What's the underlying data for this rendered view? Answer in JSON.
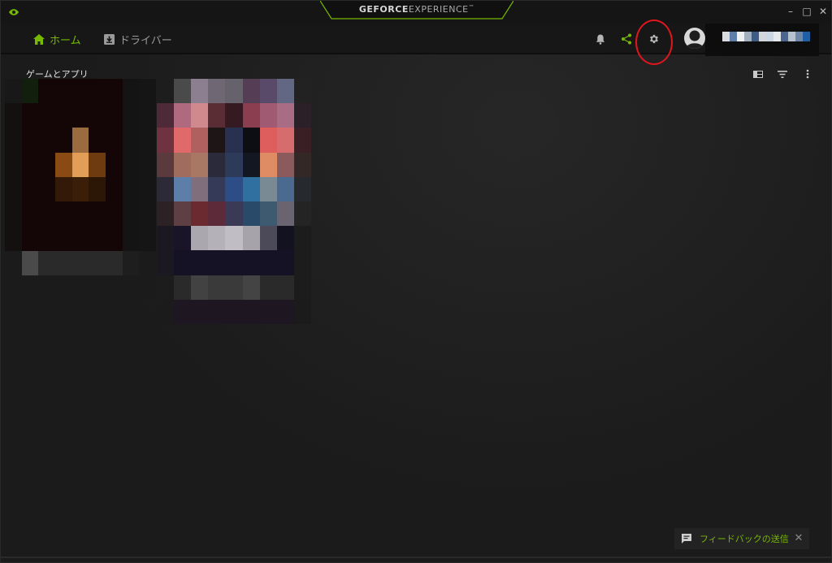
{
  "window": {
    "title_bold": "GEFORCE",
    "title_light": "EXPERIENCE",
    "title_mark": "™",
    "minimize_glyph": "–",
    "maximize_glyph": "□",
    "close_glyph": "✕"
  },
  "nav": {
    "home_label": "ホーム",
    "drivers_label": "ドライバー",
    "accent_color": "#76b900"
  },
  "section": {
    "title": "ゲームとアプリ"
  },
  "feedback": {
    "label": "フィードバックの送信",
    "close_glyph": "✕"
  },
  "icons": {
    "home": "home-icon",
    "drivers": "download-box-icon",
    "notifications": "bell-icon",
    "share": "share-icon",
    "settings": "gear-icon",
    "avatar": "user-avatar-icon",
    "layout": "grid-layout-icon",
    "filter": "filter-icon",
    "more": "more-vertical-icon",
    "feedback": "feedback-chat-icon"
  }
}
